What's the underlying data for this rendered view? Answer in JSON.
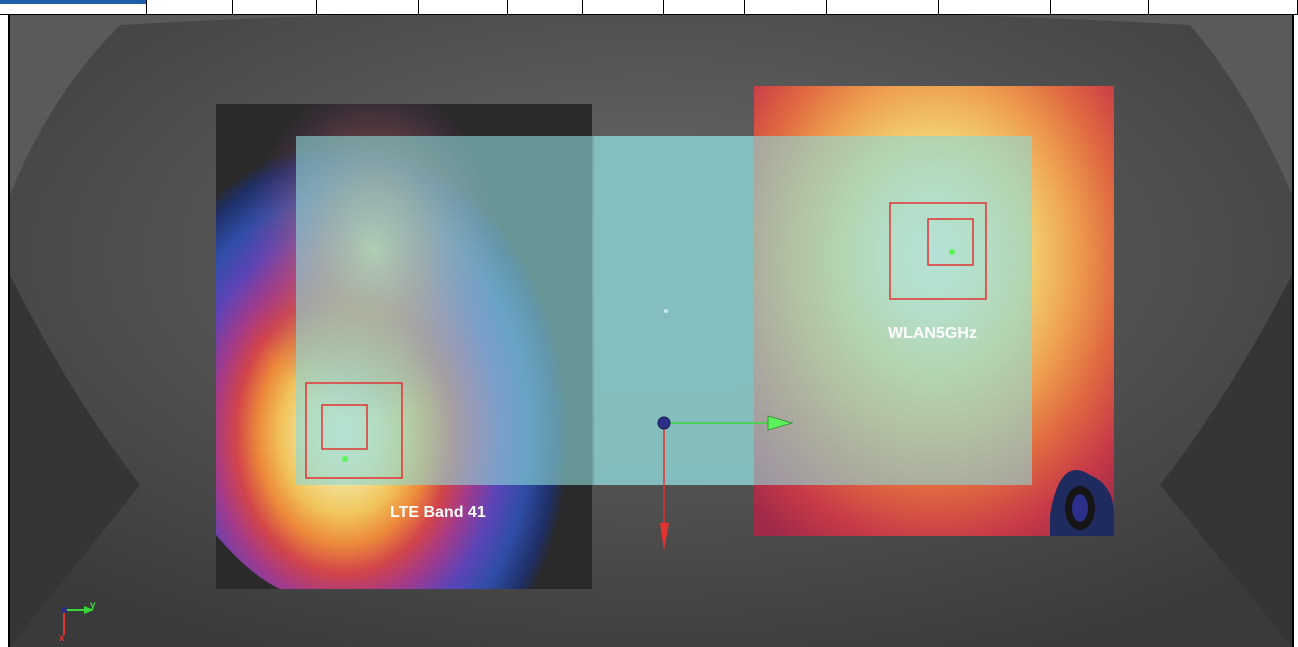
{
  "viewport": {
    "background": "#4a4a4a",
    "wlan_panel": {
      "label": "WLAN5GHz"
    },
    "lte_panel": {
      "label": "LTE Band 41"
    },
    "plane_color": "#8cd6d6",
    "axis_colors": {
      "x": "#e23232",
      "y": "#38d838",
      "origin": "#2b2f8a"
    },
    "orientation_triad": {
      "y_label": "y",
      "x_label": "x"
    }
  }
}
